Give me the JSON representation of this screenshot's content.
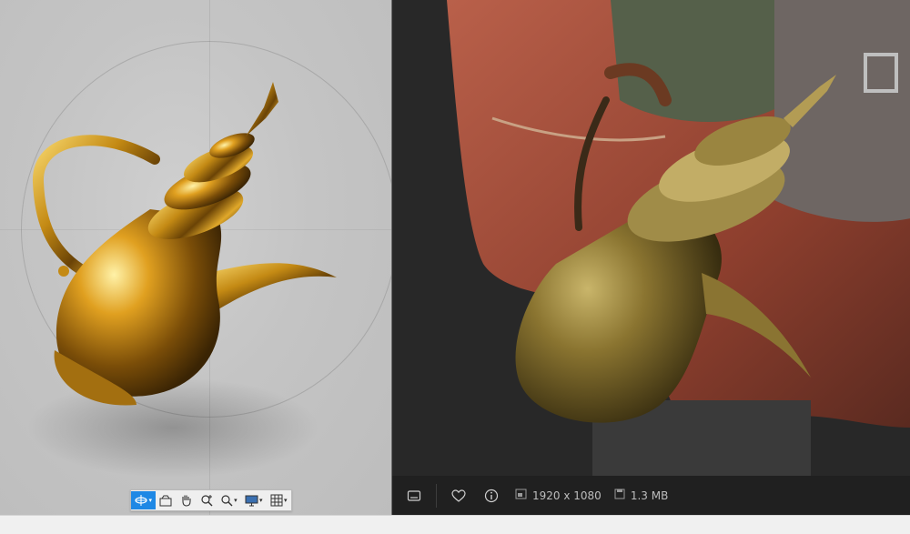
{
  "cad_viewport": {
    "toolbar": {
      "items": [
        {
          "icon": "orbit-icon",
          "has_dropdown": true,
          "active": true
        },
        {
          "icon": "look-at-icon",
          "has_dropdown": false,
          "active": false
        },
        {
          "icon": "pan-hand-icon",
          "has_dropdown": false,
          "active": false
        },
        {
          "icon": "zoom-icon",
          "has_dropdown": false,
          "active": false
        },
        {
          "icon": "fit-zoom-icon",
          "has_dropdown": true,
          "active": false
        },
        {
          "icon": "display-settings-icon",
          "has_dropdown": true,
          "active": false
        },
        {
          "icon": "grid-icon",
          "has_dropdown": true,
          "active": false
        }
      ],
      "accent_color": "#1e88e5"
    }
  },
  "photo_viewer": {
    "status_bar": {
      "resolution": "1920 x 1080",
      "file_size": "1.3 MB",
      "icons": [
        "filmstrip-icon",
        "favorite-heart-icon",
        "info-icon",
        "resolution-icon",
        "disk-size-icon"
      ]
    }
  }
}
